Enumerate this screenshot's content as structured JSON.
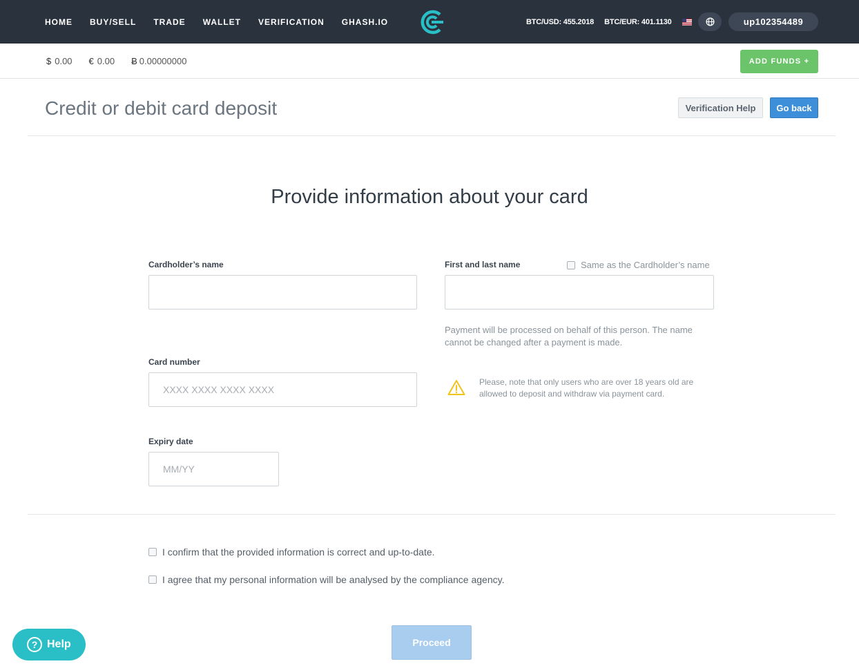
{
  "nav": {
    "items": [
      {
        "label": "HOME"
      },
      {
        "label": "BUY/SELL"
      },
      {
        "label": "TRADE"
      },
      {
        "label": "WALLET"
      },
      {
        "label": "VERIFICATION"
      },
      {
        "label": "GHASH.IO"
      }
    ],
    "btc_usd": "BTC/USD: 455.2018",
    "btc_eur": "BTC/EUR: 401.1130",
    "username": "up102354489"
  },
  "balances": {
    "usd_symbol": "$",
    "usd_value": "0.00",
    "eur_symbol": "€",
    "eur_value": "0.00",
    "btc_symbol": "Ƀ",
    "btc_value": "0.00000000",
    "add_funds_label": "ADD FUNDS +"
  },
  "header": {
    "title": "Credit or debit card deposit",
    "verification_help_label": "Verification Help",
    "go_back_label": "Go back"
  },
  "form": {
    "heading": "Provide information about your card",
    "cardholder_label": "Cardholder’s name",
    "cardholder_value": "",
    "first_last_label": "First and last name",
    "first_last_value": "",
    "same_as_label": "Same as the Cardholder’s name",
    "processing_note": "Payment will be processed on behalf of this person. The name cannot be changed after a payment is made.",
    "card_number_label": "Card number",
    "card_number_placeholder": "XXXX XXXX XXXX XXXX",
    "age_warning": "Please, note that only users who are over 18 years old are allowed to deposit and withdraw via payment card.",
    "expiry_label": "Expiry date",
    "expiry_placeholder": "MM/YY",
    "confirm_info_label": "I confirm that the provided information is correct and up-to-date.",
    "agree_compliance_label": "I agree that my personal information will be analysed by the compliance agency.",
    "proceed_label": "Proceed"
  },
  "help_widget": {
    "icon_glyph": "?",
    "label": "Help"
  },
  "colors": {
    "nav_bg": "#2a323d",
    "brand_accent": "#2abfc7",
    "add_funds_green": "#6cc46a",
    "primary_blue": "#3e8fd9",
    "warning_yellow": "#f0c419"
  },
  "icons": {
    "logo": "cex-logo-icon",
    "flag": "us-flag-icon",
    "language": "globe-icon",
    "warning": "warning-triangle-icon",
    "help": "question-circle-icon"
  }
}
